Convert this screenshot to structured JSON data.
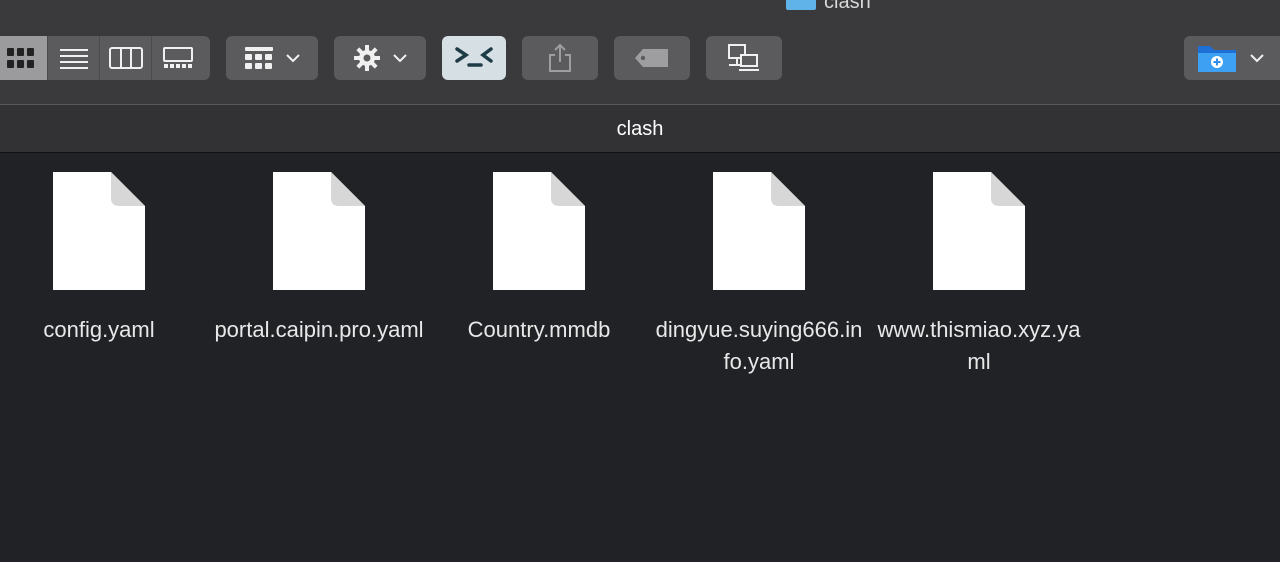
{
  "window": {
    "title": "clash"
  },
  "toolbar": {
    "view_modes": [
      {
        "name": "view-icons-button",
        "icon": "grid-icon",
        "active": true
      },
      {
        "name": "view-list-button",
        "icon": "list-icon",
        "active": false
      },
      {
        "name": "view-columns-button",
        "icon": "columns-icon",
        "active": false
      },
      {
        "name": "view-gallery-button",
        "icon": "gallery-icon",
        "active": false
      }
    ],
    "group_menu_icon": "group-by-icon",
    "action_menu_icon": "gear-icon",
    "terminal_icon": "terminal-icon",
    "share_icon": "share-icon",
    "tag_icon": "tag-icon",
    "connect_icon": "connect-server-icon",
    "new_folder_icon": "new-folder-icon"
  },
  "pathbar": {
    "title": "clash"
  },
  "files": [
    {
      "name": "config.yaml"
    },
    {
      "name": "portal.caipin.pro.yaml"
    },
    {
      "name": "Country.mmdb"
    },
    {
      "name": "dingyue.suying666.info.yaml"
    },
    {
      "name": "www.thismiao.xyz.yaml"
    }
  ],
  "colors": {
    "background": "#202226",
    "toolbar": "#3a3a3c",
    "button": "#5b5b5e",
    "folder_blue": "#2e8ff0"
  }
}
